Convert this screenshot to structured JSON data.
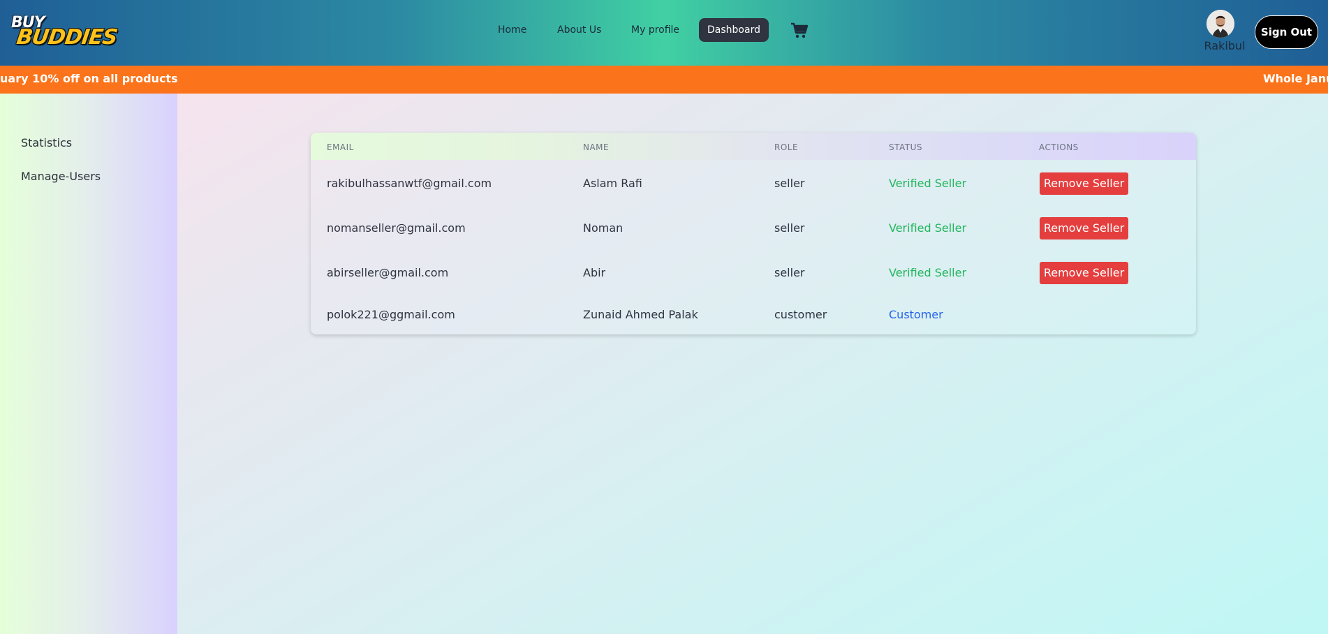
{
  "header": {
    "logo_line1": "BUY",
    "logo_line2": "BUDDIES",
    "nav": {
      "home": "Home",
      "about": "About Us",
      "profile": "My profile",
      "dashboard": "Dashboard"
    },
    "user_name": "Rakibul",
    "sign_out": "Sign Out"
  },
  "promo": {
    "text_left": "uary 10% off on all products",
    "text_right": "Whole Janu"
  },
  "sidebar": {
    "items": [
      {
        "label": "Statistics"
      },
      {
        "label": "Manage-Users"
      }
    ]
  },
  "table": {
    "headers": {
      "email": "EMAIL",
      "name": "NAME",
      "role": "ROLE",
      "status": "STATUS",
      "actions": "ACTIONS"
    },
    "rows": [
      {
        "email": "rakibulhassanwtf@gmail.com",
        "name": "Aslam Rafi",
        "role": "seller",
        "status": "Verified Seller",
        "action": "Remove Seller"
      },
      {
        "email": "nomanseller@gmail.com",
        "name": "Noman",
        "role": "seller",
        "status": "Verified Seller",
        "action": "Remove Seller"
      },
      {
        "email": "abirseller@gmail.com",
        "name": "Abir",
        "role": "seller",
        "status": "Verified Seller",
        "action": "Remove Seller"
      },
      {
        "email": "polok221@ggmail.com",
        "name": "Zunaid Ahmed Palak",
        "role": "customer",
        "status": "Customer",
        "action": ""
      }
    ]
  },
  "colors": {
    "verified": "#22b55d",
    "customer": "#2563eb",
    "remove_button": "#e53e3e",
    "promo_bar": "#fb741b",
    "dashboard_button": "#2f3440"
  },
  "icons": {
    "cart": "shopping-cart-icon",
    "avatar": "user-avatar"
  }
}
